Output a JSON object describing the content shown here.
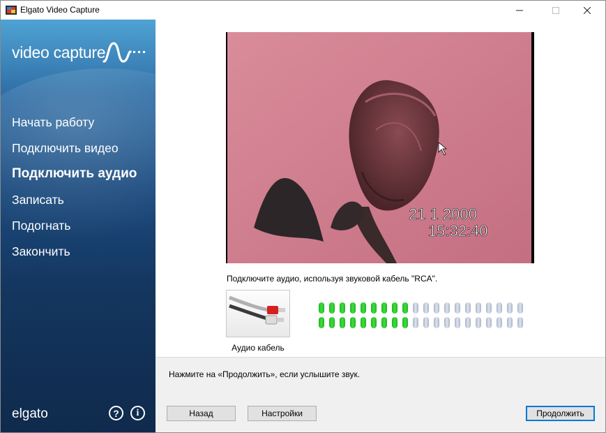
{
  "window": {
    "title": "Elgato Video Capture",
    "controls": [
      "minimize",
      "maximize",
      "close"
    ]
  },
  "sidebar": {
    "logo": "video capture",
    "nav": [
      {
        "label": "Начать работу",
        "active": false
      },
      {
        "label": "Подключить видео",
        "active": false
      },
      {
        "label": "Подключить аудио",
        "active": true
      },
      {
        "label": "Записать",
        "active": false
      },
      {
        "label": "Подогнать",
        "active": false
      },
      {
        "label": "Закончить",
        "active": false
      }
    ],
    "brand": "elgato",
    "help_icon": "?",
    "info_icon": "i"
  },
  "preview": {
    "date_overlay": "21  1 2000",
    "time_overlay": "15:32:40"
  },
  "audio": {
    "instruction": "Подключите аудио, используя звуковой кабель \"RCA\".",
    "cable_label": "Аудио кабель",
    "meter": {
      "total_leds": 20,
      "rows": [
        {
          "channel": "left",
          "lit": 9
        },
        {
          "channel": "right",
          "lit": 9
        }
      ]
    }
  },
  "footer": {
    "hint": "Нажмите на «Продолжить», если услышите звук.",
    "back_label": "Назад",
    "settings_label": "Настройки",
    "continue_label": "Продолжить"
  },
  "colors": {
    "accent": "#0078d7",
    "led_on": "#2ecc2e",
    "led_off": "#c9d1e0",
    "sidebar_top": "#4fa3d4",
    "sidebar_bottom": "#0f2a4c"
  }
}
